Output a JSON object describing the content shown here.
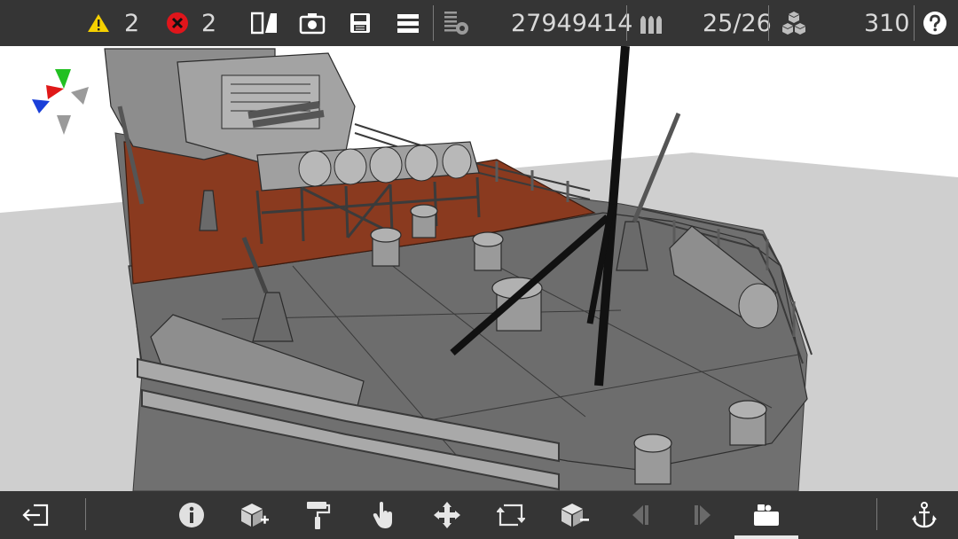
{
  "toolbar": {
    "warnings_count": "2",
    "errors_count": "2",
    "poly_count": "27949414",
    "ammo_count": "25/26",
    "parts_count": "310"
  },
  "colors": {
    "bar_bg": "#353535",
    "warning": "#f5d000",
    "error": "#e0151b",
    "deck_wood": "#8a3a1f",
    "hull_gray": "#6f6f6f",
    "floor": "#cfcfcf"
  },
  "icons": {
    "top": [
      "warning-icon",
      "error-icon",
      "split-view-icon",
      "camera-icon",
      "save-icon",
      "menu-icon",
      "polygon-stats-icon",
      "ammo-icon",
      "parts-icon",
      "help-icon"
    ],
    "bottom": [
      "exit-icon",
      "info-icon",
      "add-part-icon",
      "paint-roller-icon",
      "touch-select-icon",
      "move-icon",
      "rotate-icon",
      "remove-part-icon",
      "step-back-icon",
      "step-forward-icon",
      "camera-view-icon",
      "anchor-icon"
    ]
  },
  "bottom_active_tool": "camera-view"
}
